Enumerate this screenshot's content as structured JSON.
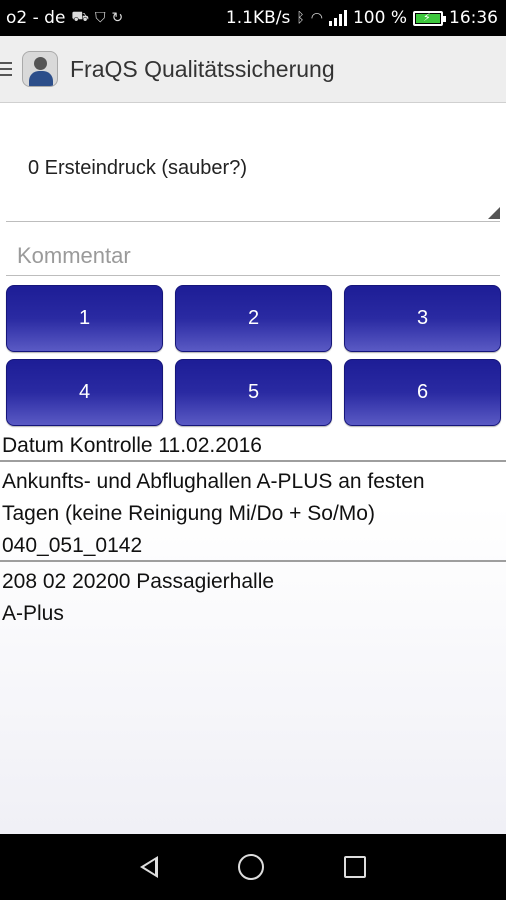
{
  "status_bar": {
    "carrier": "o2 - de",
    "speed": "1.1KB/s",
    "battery": "100 %",
    "time": "16:36",
    "icons": [
      "car-icon",
      "shield-icon",
      "sync-icon",
      "bluetooth-icon",
      "wifi-icon",
      "signal-icon",
      "battery-charging-icon"
    ]
  },
  "app_bar": {
    "title": "FraQS Qualitätssicherung",
    "icons": [
      "menu-icon",
      "app-logo-icon"
    ]
  },
  "form": {
    "spinner_value": "0 Ersteindruck (sauber?)",
    "comment_placeholder": "Kommentar",
    "buttons": [
      "1",
      "2",
      "3",
      "4",
      "5",
      "6"
    ]
  },
  "info": {
    "date": "Datum Kontrolle 11.02.2016",
    "area_line1": "Ankunfts- und Abflughallen A-PLUS an festen",
    "area_line2": "Tagen (keine Reinigung Mi/Do + So/Mo)",
    "area_code": "040_051_0142",
    "room_line1": "208 02 20200 Passagierhalle",
    "room_line2": "A-Plus"
  },
  "nav_bar": {
    "icons": [
      "back-icon",
      "home-icon",
      "recent-apps-icon"
    ]
  },
  "colors": {
    "button_blue": "#2a2aa2",
    "app_bar_bg": "#eeeeee",
    "battery_green": "#3ec83e"
  }
}
